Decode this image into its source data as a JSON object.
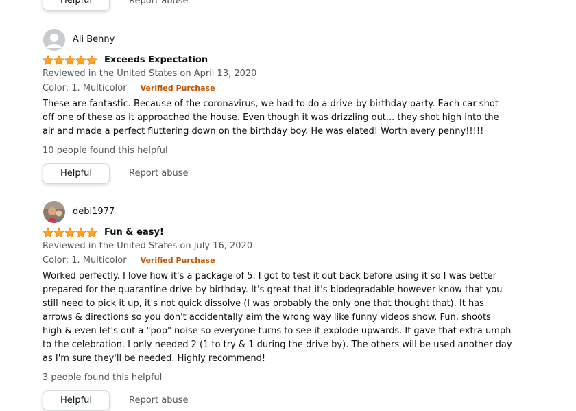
{
  "actions": {
    "helpful_label": "Helpful",
    "report_label": "Report abuse"
  },
  "reviews": [
    {
      "reviewer": "Ali Benny",
      "rating": 5,
      "title": "Exceeds Expectation",
      "date": "Reviewed in the United States on April 13, 2020",
      "color": "Color: 1. Multicolor",
      "verified": "Verified Purchase",
      "body": "These are fantastic. Because of the coronavirus, we had to do a drive-by birthday party. Each car shot off one of these as it approached the house. Even though it was drizzling out... they shot high into the air and made a perfect fluttering down on the birthday boy. He was elated! Worth every penny!!!!!",
      "helpful_count": "10 people found this helpful"
    },
    {
      "reviewer": "debi1977",
      "rating": 5,
      "title": "Fun & easy!",
      "date": "Reviewed in the United States on July 16, 2020",
      "color": "Color: 1. Multicolor",
      "verified": "Verified Purchase",
      "body": "Worked perfectly. I love how it's a package of 5. I got to test it out back before using it so I was better prepared for the quarantine drive-by birthday. It's great that it's biodegradable however know that you still need to pick it up, it's not quick dissolve (I was probably the only one that thought that). It has arrows & directions so you don't accidentally aim the wrong way like funny videos show. Fun, shoots high & even let's out a \"pop\" noise so everyone turns to see it explode upwards. It gave that extra umph to the celebration. I only needed 2 (1 to try & 1 during the drive by). The others will be used another day as I'm sure they'll be needed. Highly recommend!",
      "helpful_count": "3 people found this helpful"
    }
  ],
  "colors": {
    "star": "#ffa41c",
    "verified": "#c45500",
    "muted_text": "#565959"
  },
  "icons": {
    "star": "star-icon",
    "default_avatar": "default-avatar-icon"
  }
}
